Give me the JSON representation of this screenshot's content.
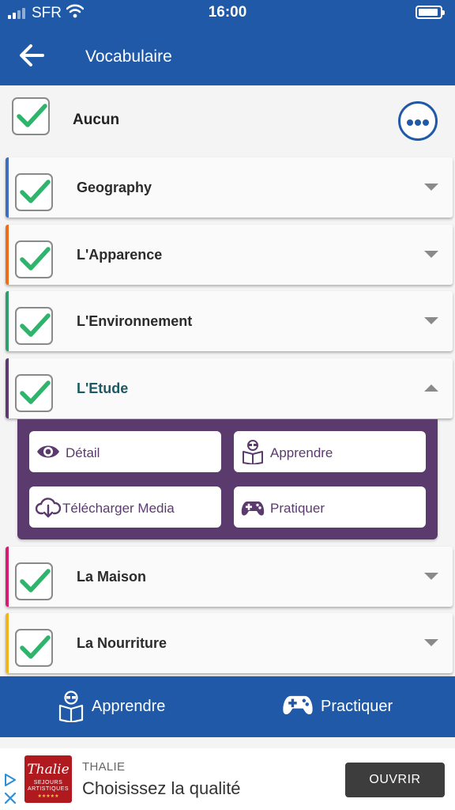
{
  "status_bar": {
    "carrier": "SFR",
    "time": "16:00"
  },
  "header": {
    "title": "Vocabulaire"
  },
  "aucun": {
    "label": "Aucun",
    "checked": true
  },
  "categories": [
    {
      "label": "Geography",
      "color": "#3e6dbf",
      "checked": true,
      "expanded": false
    },
    {
      "label": "L'Apparence",
      "color": "#ef6c1a",
      "checked": true,
      "expanded": false
    },
    {
      "label": "L'Environnement",
      "color": "#2e9e6c",
      "checked": true,
      "expanded": false
    },
    {
      "label": "L'Etude",
      "color": "#5b3a6d",
      "checked": true,
      "expanded": true
    },
    {
      "label": "La Maison",
      "color": "#d81b72",
      "checked": true,
      "expanded": false
    },
    {
      "label": "La Nourriture",
      "color": "#f2b51d",
      "checked": true,
      "expanded": false
    }
  ],
  "panel": {
    "detail": "Détail",
    "apprendre": "Apprendre",
    "telecharger": "Télécharger Media",
    "pratiquer": "Pratiquer"
  },
  "bottom_bar": {
    "apprendre": "Apprendre",
    "practiquer": "Practiquer"
  },
  "ad": {
    "logo_name": "Thalie",
    "logo_sub": "SEJOURS ARTISTIQUES",
    "logo_stars": "★★★★★",
    "brand": "THALIE",
    "tagline": "Choisissez la qualité",
    "cta": "OUVRIR"
  },
  "colors": {
    "primary": "#1f59a8",
    "check": "#2fb46c",
    "panel": "#5b3a6d"
  }
}
